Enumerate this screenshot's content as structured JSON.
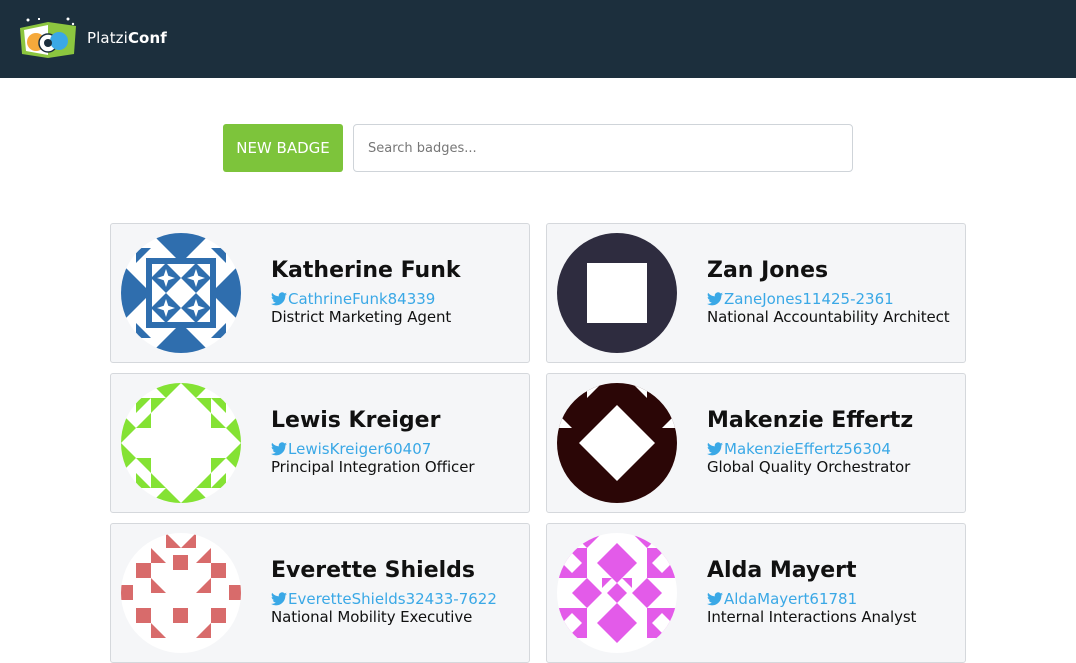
{
  "brand": {
    "name_light": "Platzi",
    "name_bold": "Conf",
    "logo_icon": "platziconf-logo-icon"
  },
  "toolbar": {
    "new_badge_label": "NEW BADGE",
    "search_placeholder": "Search badges...",
    "search_value": ""
  },
  "colors": {
    "navbar": "#1c2f3d",
    "accent_green": "#7dc43b",
    "twitter_blue": "#3aa8e6",
    "card_bg": "#f5f6f8"
  },
  "badges": [
    {
      "name": "Katherine Funk",
      "twitter": "CathrineFunk84339",
      "job": "District Marketing Agent",
      "avatar_color": "#2f6eae"
    },
    {
      "name": "Zan Jones",
      "twitter": "ZaneJones11425-2361",
      "job": "National Accountability Architect",
      "avatar_color": "#2e2c3f"
    },
    {
      "name": "Lewis Kreiger",
      "twitter": "LewisKreiger60407",
      "job": "Principal Integration Officer",
      "avatar_color": "#84e234"
    },
    {
      "name": "Makenzie Effertz",
      "twitter": "MakenzieEffertz56304",
      "job": "Global Quality Orchestrator",
      "avatar_color": "#2b0606"
    },
    {
      "name": "Everette Shields",
      "twitter": "EveretteShields32433-7622",
      "job": "National Mobility Executive",
      "avatar_color": "#d86b6b"
    },
    {
      "name": "Alda Mayert",
      "twitter": "AldaMayert61781",
      "job": "Internal Interactions Analyst",
      "avatar_color": "#e35be9"
    }
  ]
}
